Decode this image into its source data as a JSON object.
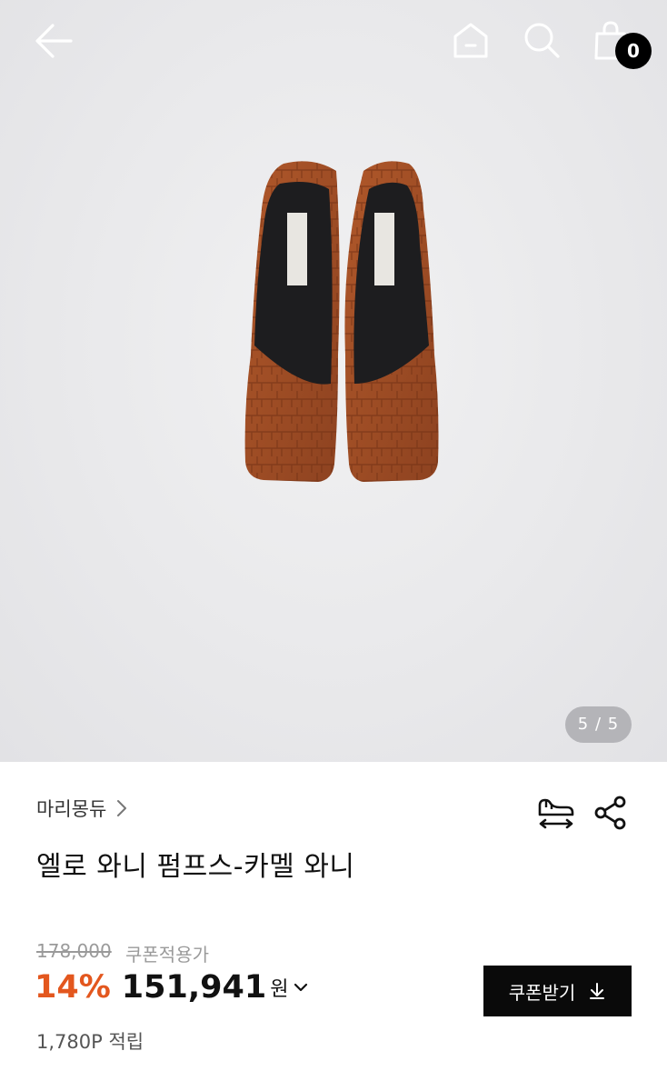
{
  "header": {
    "cart_count": "0",
    "icons": [
      "back-arrow-icon",
      "home-icon",
      "search-icon",
      "shopping-bag-icon"
    ]
  },
  "gallery": {
    "current_page": 5,
    "total_pages": 5,
    "indicator": "5 / 5"
  },
  "product": {
    "brand": "마리몽듀",
    "title": "엘로 와니 펌프스-카멜 와니",
    "original_price": "178,000",
    "coupon_label": "쿠폰적용가",
    "discount": "14%",
    "sale_price": "151,941",
    "currency": "원",
    "points": "1,780P 적립",
    "coupon_button": "쿠폰받기"
  },
  "colors": {
    "discount": "#e3571e",
    "button_bg": "#0a0a0a",
    "shoe_leather": "#9a4a24"
  }
}
